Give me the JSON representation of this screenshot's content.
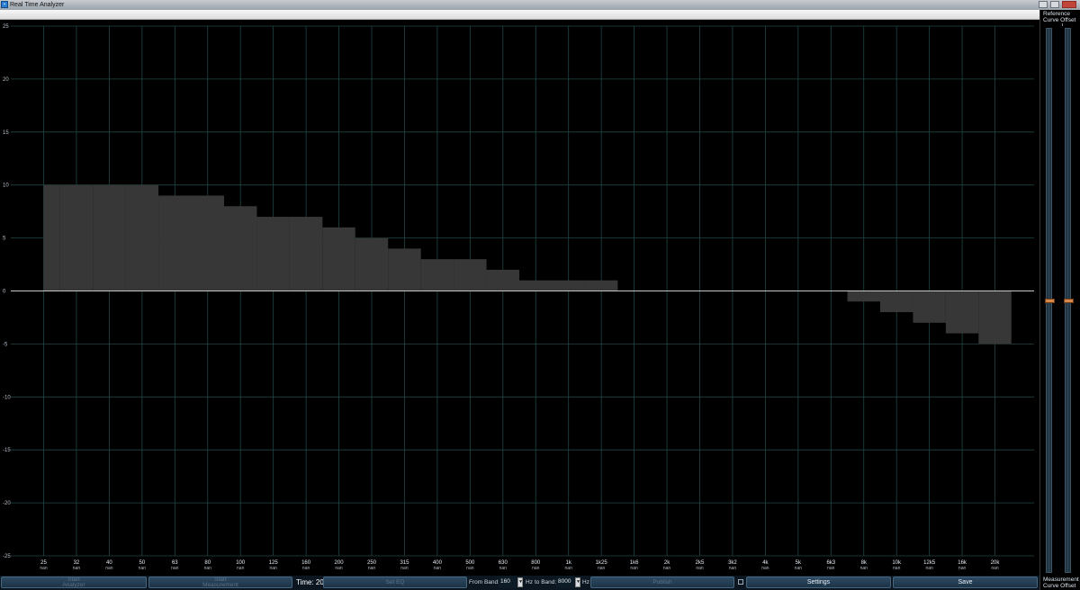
{
  "window": {
    "title": "Real Time Analyzer"
  },
  "chart_data": {
    "type": "bar",
    "y_range": [
      -25,
      25
    ],
    "y_ticks": [
      "25",
      "20",
      "15",
      "10",
      "5",
      "0",
      "-5",
      "-10",
      "-15",
      "-20",
      "-25"
    ],
    "categories": [
      "25",
      "32",
      "40",
      "50",
      "63",
      "80",
      "100",
      "125",
      "160",
      "200",
      "250",
      "315",
      "400",
      "500",
      "630",
      "800",
      "1k",
      "1k25",
      "1k6",
      "2k",
      "2k5",
      "3k2",
      "4k",
      "5k",
      "6k3",
      "8k",
      "10k",
      "12k5",
      "16k",
      "20k"
    ],
    "sub_labels": [
      "nan",
      "nan",
      "nan",
      "nan",
      "nan",
      "nan",
      "nan",
      "nan",
      "nan",
      "nan",
      "nan",
      "nan",
      "nan",
      "nan",
      "nan",
      "nan",
      "nan",
      "nan",
      "nan",
      "nan",
      "nan",
      "nan",
      "nan",
      "nan",
      "nan",
      "nan",
      "nan",
      "nan",
      "nan",
      "nan"
    ],
    "values": [
      10,
      10,
      10,
      10,
      9,
      9,
      8,
      7,
      7,
      6,
      5,
      4,
      3,
      3,
      2,
      1,
      1,
      1,
      0,
      0,
      0,
      0,
      0,
      0,
      0,
      -1,
      -2,
      -3,
      -4,
      -5
    ],
    "grid": true,
    "colors": {
      "bar": "#373737",
      "grid": "#1f4646",
      "zero_line": "#c8c8c8",
      "background": "#000000"
    }
  },
  "sidebar": {
    "reference_label": "Reference\nCurve Offset",
    "measurement_label": "Measurement\nCurve Offset",
    "reference_offset": 0.5,
    "measurement_offset": 0.5
  },
  "toolbar": {
    "start_analyzer": "Start\nAnalyzer",
    "start_measurement": "Start\nMeasurement",
    "time_label": "Time: 20",
    "set_eq": "Set EQ",
    "from_band_label": "From Band:",
    "from_band_value": "160",
    "hz1": "Hz",
    "to_band_label": "to Band:",
    "to_band_value": "8000",
    "hz2": "Hz",
    "publish": "Publish",
    "settings": "Settings",
    "save": "Save"
  }
}
